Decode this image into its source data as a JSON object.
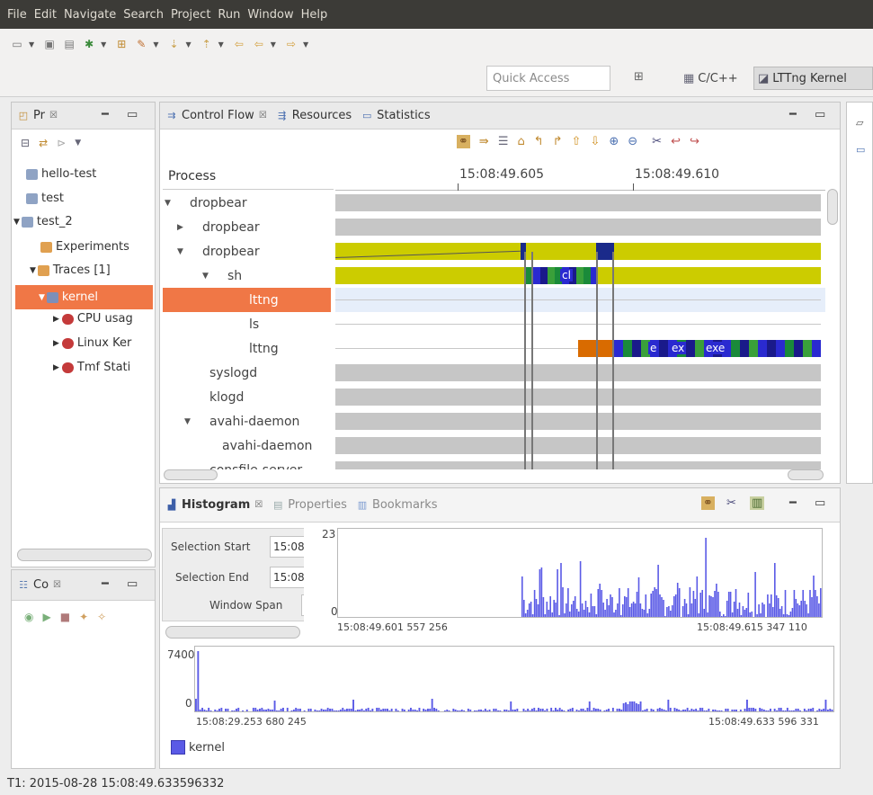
{
  "menu": [
    "File",
    "Edit",
    "Navigate",
    "Search",
    "Project",
    "Run",
    "Window",
    "Help"
  ],
  "toolbar": {
    "quick_access_placeholder": "Quick Access",
    "perspective_cc": "C/C++",
    "perspective_lttng": "LTTng Kernel"
  },
  "project_explorer": {
    "tab_label": "Pr",
    "items": [
      {
        "label": "hello-test"
      },
      {
        "label": "test"
      },
      {
        "label": "test_2"
      },
      {
        "label": "Experiments"
      },
      {
        "label": "Traces [1]"
      },
      {
        "label": "kernel"
      },
      {
        "label": "CPU usag"
      },
      {
        "label": "Linux Ker"
      },
      {
        "label": "Tmf Stati"
      }
    ]
  },
  "control_panel": {
    "tab_label": "Co"
  },
  "control_flow": {
    "tabs": [
      "Control Flow",
      "Resources",
      "Statistics"
    ],
    "process_header": "Process",
    "time_ticks": [
      "15:08:49.605",
      "15:08:49.610"
    ],
    "processes": [
      {
        "label": "dropbear"
      },
      {
        "label": "dropbear"
      },
      {
        "label": "dropbear"
      },
      {
        "label": "sh"
      },
      {
        "label": "lttng"
      },
      {
        "label": "ls"
      },
      {
        "label": "lttng"
      },
      {
        "label": "syslogd"
      },
      {
        "label": "klogd"
      },
      {
        "label": "avahi-daemon"
      },
      {
        "label": "avahi-daemon"
      },
      {
        "label": "consfile-server"
      }
    ],
    "event_labels": [
      "cl",
      "e",
      "ex",
      "exe"
    ]
  },
  "histogram": {
    "tabs": [
      "Histogram",
      "Properties",
      "Bookmarks"
    ],
    "selection_start_label": "Selection Start",
    "selection_start_value": "15:08",
    "selection_end_label": "Selection End",
    "selection_end_value": "15:08",
    "window_span_label": "Window Span",
    "top_ymax": "23",
    "top_ymin": "0",
    "top_start": "15:08:49.601 557 256",
    "top_end": "15:08:49.615 347 110",
    "bottom_ymax": "7400",
    "bottom_ymin": "0",
    "bottom_start": "15:08:29.253 680 245",
    "bottom_end": "15:08:49.633 596 331",
    "legend": "kernel",
    "bar_color": "#5a5ae6"
  },
  "status": "T1: 2015-08-28 15:08:49.633596332"
}
